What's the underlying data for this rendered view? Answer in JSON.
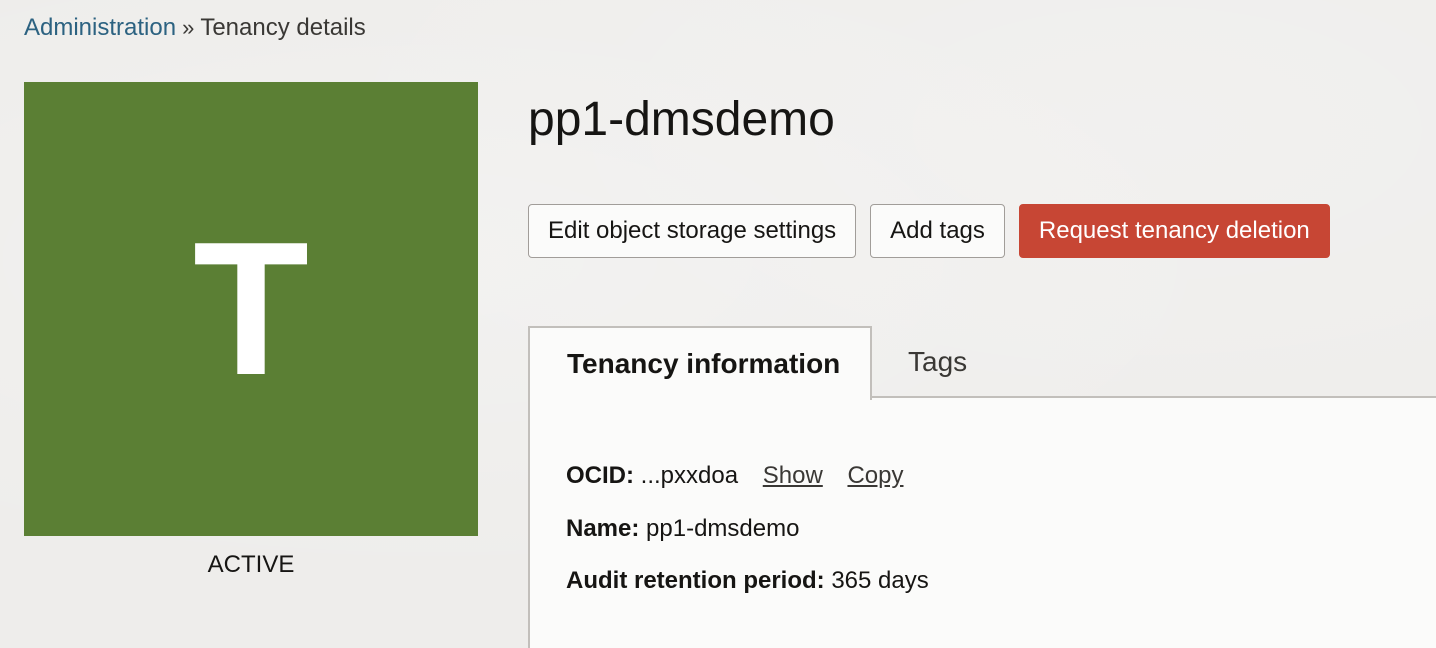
{
  "breadcrumb": {
    "parent": "Administration",
    "separator": "»",
    "current": "Tenancy details"
  },
  "avatar": {
    "letter": "T",
    "color": "#5b7f34"
  },
  "status": "ACTIVE",
  "title": "pp1-dmsdemo",
  "actions": {
    "edit_storage": "Edit object storage settings",
    "add_tags": "Add tags",
    "request_deletion": "Request tenancy deletion",
    "danger_color": "#c74634"
  },
  "tabs": [
    {
      "label": "Tenancy information",
      "active": true
    },
    {
      "label": "Tags",
      "active": false
    }
  ],
  "info": {
    "ocid_label": "OCID:",
    "ocid_value": "...pxxdoa",
    "show_link": "Show",
    "copy_link": "Copy",
    "name_label": "Name:",
    "name_value": "pp1-dmsdemo",
    "audit_label": "Audit retention period:",
    "audit_value": "365 days"
  },
  "colors": {
    "link": "#2c6281",
    "background": "#eeedeb",
    "panel": "#fbfbfa"
  }
}
